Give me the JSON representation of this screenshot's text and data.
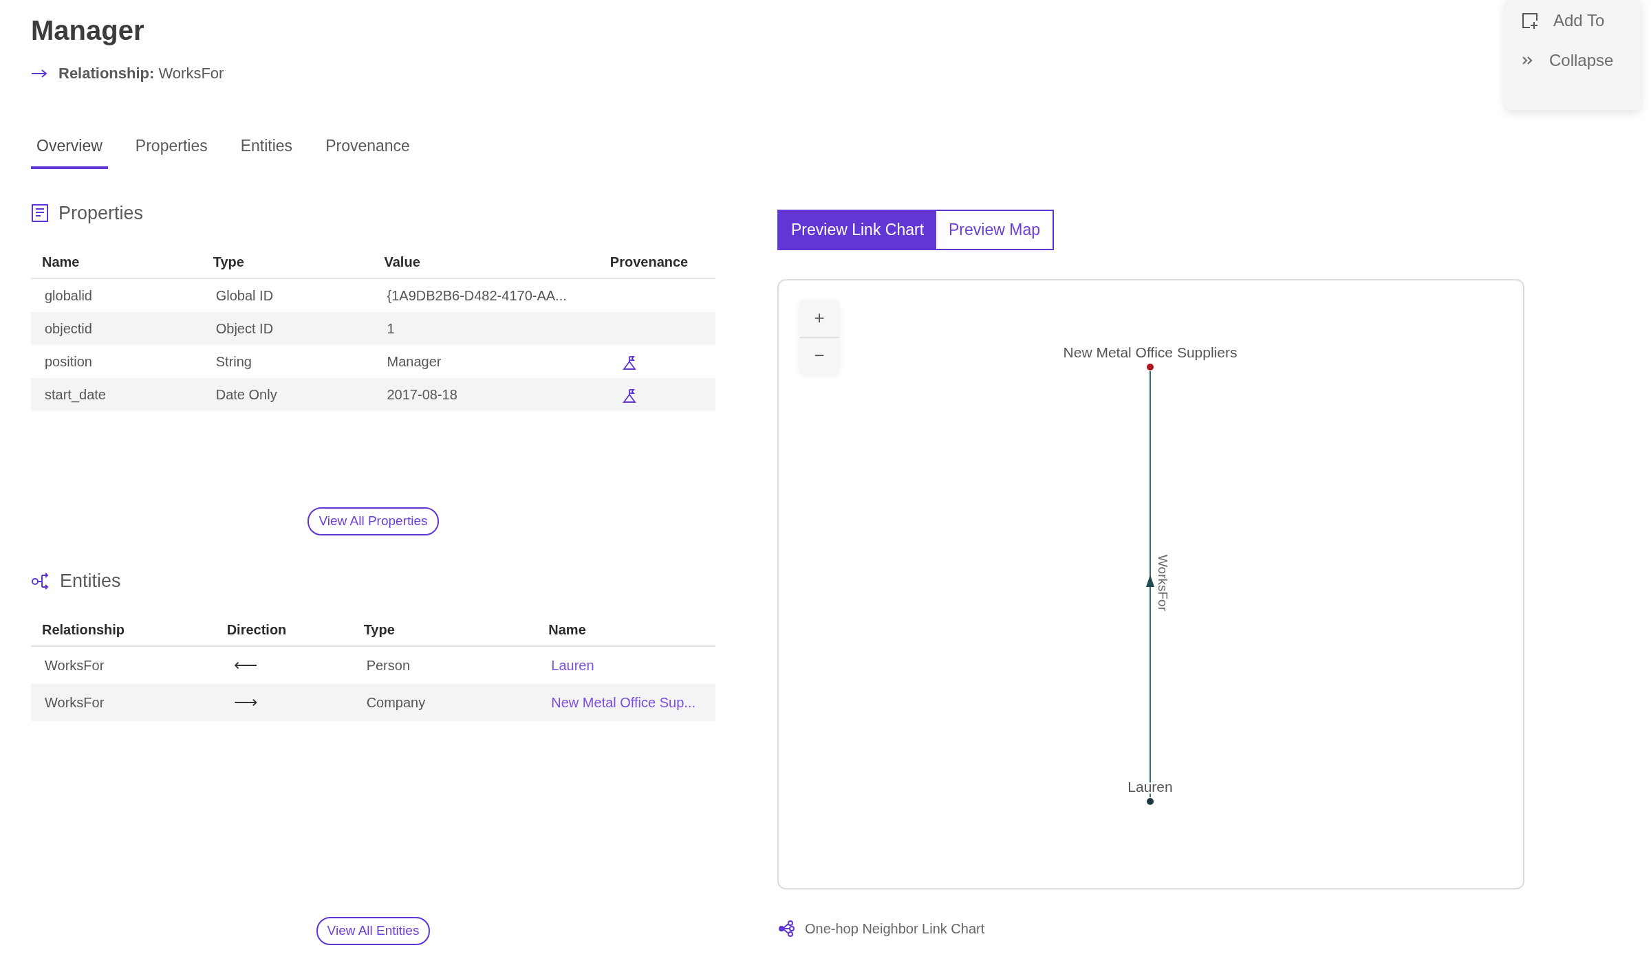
{
  "header": {
    "title": "Manager",
    "relationship_label": "Relationship:",
    "relationship_value": "WorksFor"
  },
  "actions": [
    {
      "kind": "add",
      "label": "Add To"
    },
    {
      "kind": "collapse",
      "label": "Collapse"
    }
  ],
  "tabs": [
    {
      "label": "Overview",
      "selected": true
    },
    {
      "label": "Properties",
      "selected": false
    },
    {
      "label": "Entities",
      "selected": false
    },
    {
      "label": "Provenance",
      "selected": false
    }
  ],
  "properties": {
    "title": "Properties",
    "columns": [
      "Name",
      "Type",
      "Value",
      "Provenance"
    ],
    "rows": [
      {
        "name": "globalid",
        "type": "Global ID",
        "value": "{1A9DB2B6-D482-4170-AA...",
        "provenance": false
      },
      {
        "name": "objectid",
        "type": "Object ID",
        "value": "1",
        "provenance": false
      },
      {
        "name": "position",
        "type": "String",
        "value": "Manager",
        "provenance": true
      },
      {
        "name": "start_date",
        "type": "Date Only",
        "value": "2017-08-18",
        "provenance": true
      }
    ],
    "button": "View All Properties"
  },
  "entities": {
    "title": "Entities",
    "columns": [
      "Relationship",
      "Direction",
      "Type",
      "Name"
    ],
    "rows": [
      {
        "relationship": "WorksFor",
        "direction": "⟵",
        "type": "Person",
        "name": "Lauren"
      },
      {
        "relationship": "WorksFor",
        "direction": "⟶",
        "type": "Company",
        "name": "New Metal Office Sup..."
      }
    ],
    "button": "View All Entities"
  },
  "preview_toggle": [
    {
      "label": "Preview Link Chart",
      "selected": true
    },
    {
      "label": "Preview Map",
      "selected": false
    }
  ],
  "link_chart": {
    "zoom_in": "+",
    "zoom_out": "−",
    "edge_label": "WorksFor",
    "nodes": [
      {
        "label": "New Metal Office Suppliers",
        "color": "#b0161e"
      },
      {
        "label": "Lauren",
        "color": "#1d3640"
      }
    ]
  },
  "caption": "One-hop Neighbor Link Chart"
}
